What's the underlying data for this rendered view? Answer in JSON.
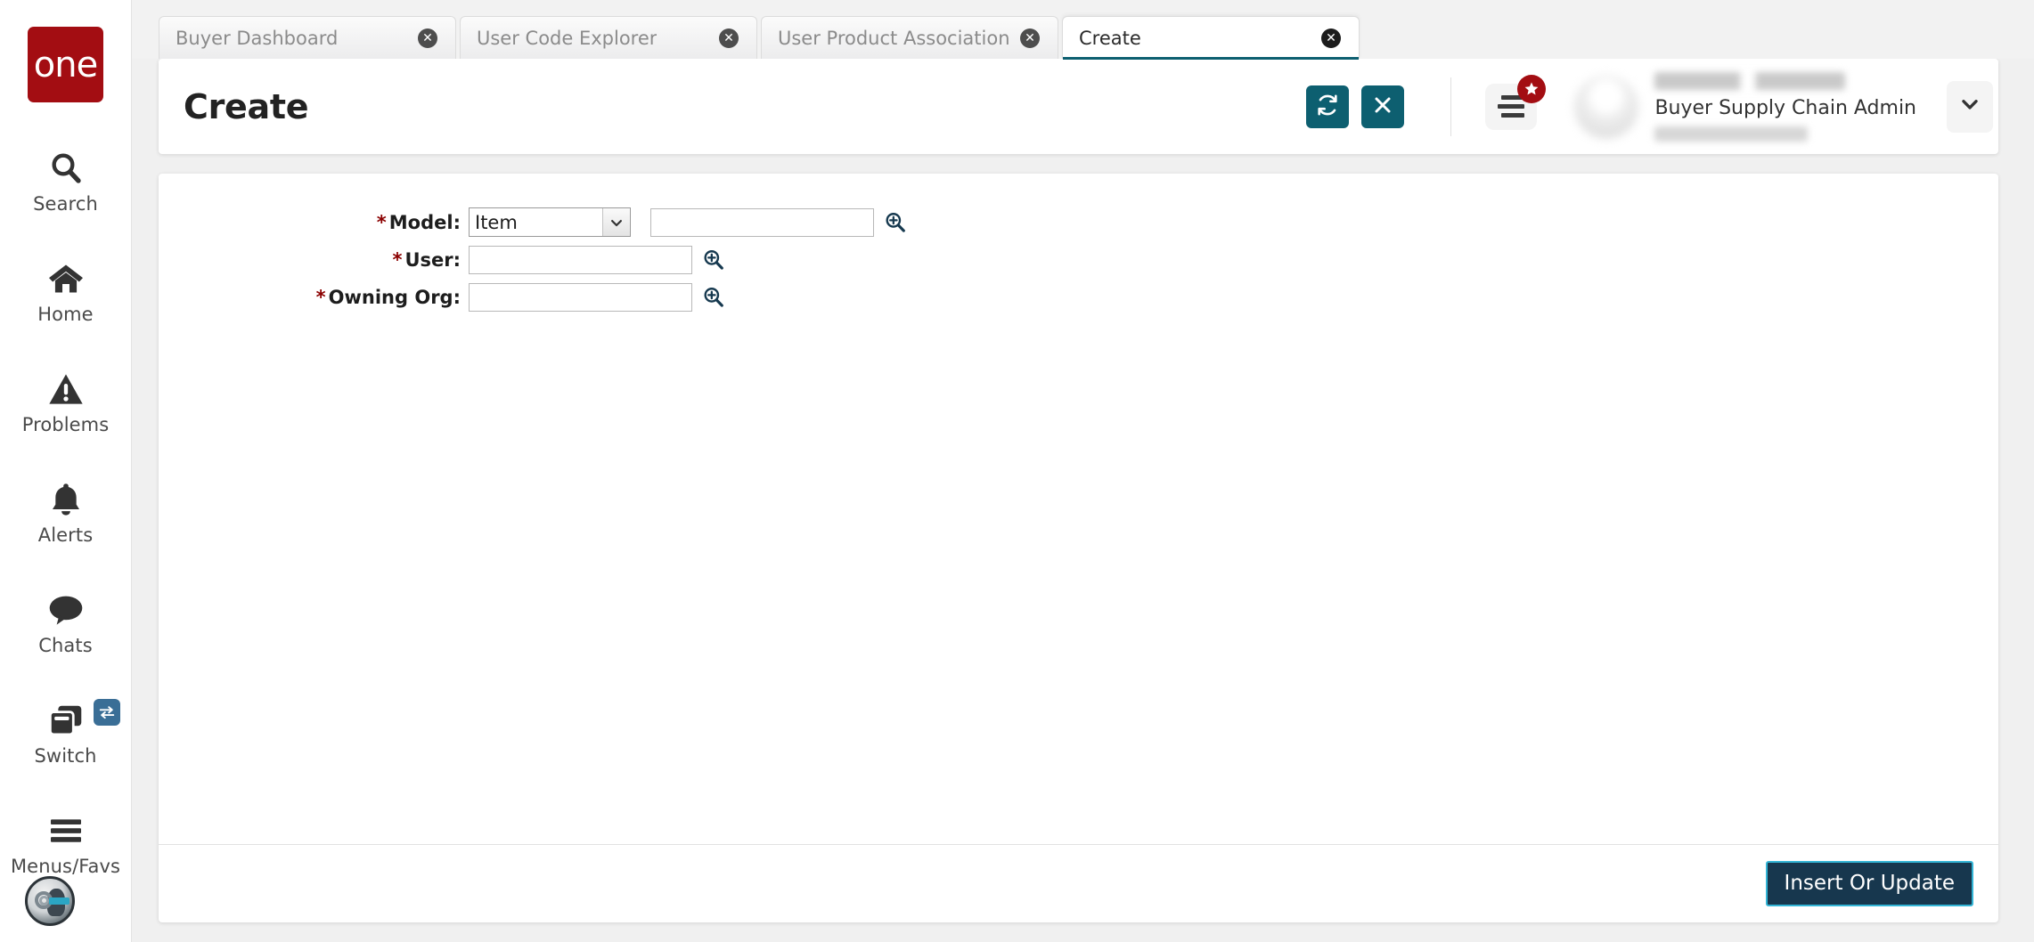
{
  "brand": {
    "logo_text": "one",
    "logo_color": "#a30d12"
  },
  "sidebar": {
    "items": [
      {
        "label": "Search",
        "icon": "search-icon"
      },
      {
        "label": "Home",
        "icon": "home-icon"
      },
      {
        "label": "Problems",
        "icon": "warning-triangle-icon"
      },
      {
        "label": "Alerts",
        "icon": "bell-icon"
      },
      {
        "label": "Chats",
        "icon": "chat-bubble-icon"
      },
      {
        "label": "Switch",
        "icon": "switch-windows-icon",
        "badge_icon": "exchange-arrows-icon"
      },
      {
        "label": "Menus/Favs",
        "icon": "hamburger-icon"
      }
    ],
    "assistant_icon": "robot-assistant-avatar"
  },
  "tabs": [
    {
      "label": "Buyer Dashboard",
      "active": false,
      "close_icon": "close-circle-icon"
    },
    {
      "label": "User Code Explorer",
      "active": false,
      "close_icon": "close-circle-icon"
    },
    {
      "label": "User Product Association",
      "active": false,
      "close_icon": "close-circle-icon"
    },
    {
      "label": "Create",
      "active": true,
      "close_icon": "close-circle-icon"
    }
  ],
  "header": {
    "title": "Create",
    "refresh_icon": "refresh-icon",
    "close_icon": "close-x-icon",
    "menu_icon": "menu-list-icon",
    "menu_badge_icon": "star-icon",
    "chevron_icon": "chevron-down-icon",
    "user_role": "Buyer Supply Chain Admin",
    "accent_color": "#0d5f70",
    "badge_color": "#a30d12"
  },
  "form": {
    "fields": [
      {
        "label": "Model",
        "required": true,
        "type": "select",
        "value": "Item",
        "options": [
          "Item"
        ],
        "extra_input": {
          "value": "",
          "placeholder": ""
        },
        "lookup_icon": "magnifier-plus-icon"
      },
      {
        "label": "User",
        "required": true,
        "type": "text",
        "value": "",
        "placeholder": "",
        "lookup_icon": "magnifier-plus-icon"
      },
      {
        "label": "Owning Org",
        "required": true,
        "type": "text",
        "value": "",
        "placeholder": "",
        "lookup_icon": "magnifier-plus-icon"
      }
    ],
    "required_marker": "*",
    "label_suffix": ":"
  },
  "footer": {
    "submit_label": "Insert Or Update",
    "submit_bg": "#17374e",
    "submit_border": "#33b5d6"
  }
}
